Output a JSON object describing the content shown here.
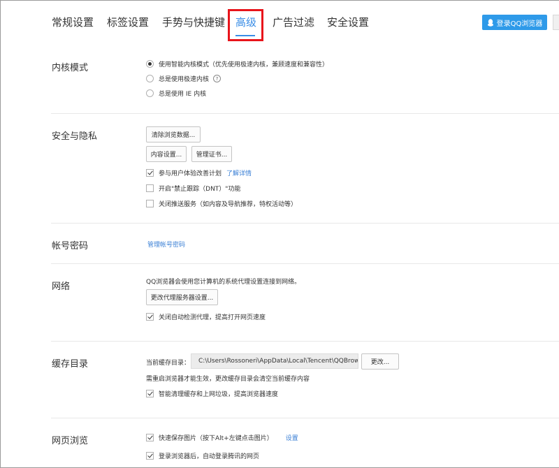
{
  "tabs": [
    {
      "label": "常规设置",
      "active": false
    },
    {
      "label": "标签设置",
      "active": false
    },
    {
      "label": "手势与快捷键",
      "active": false
    },
    {
      "label": "高级",
      "active": true
    },
    {
      "label": "广告过滤",
      "active": false
    },
    {
      "label": "安全设置",
      "active": false
    }
  ],
  "login_button": "登录QQ浏览器",
  "colors": {
    "accent": "#3a8de6",
    "highlight": "#e8141b",
    "login_bg": "#2e9ae9",
    "link": "#3a7fd5"
  },
  "kernel": {
    "title": "内核模式",
    "options": [
      {
        "label": "使用智能内核模式（优先使用极速内核，兼顾速度和兼容性）",
        "selected": true
      },
      {
        "label": "总是使用极速内核",
        "selected": false,
        "help": "?"
      },
      {
        "label": "总是使用 IE 内核",
        "selected": false
      }
    ]
  },
  "security": {
    "title": "安全与隐私",
    "clear_data_button": "清除浏览数据...",
    "content_settings_button": "内容设置...",
    "manage_certs_button": "管理证书...",
    "checks": [
      {
        "label": "参与用户体验改善计划",
        "checked": true,
        "link": "了解详情"
      },
      {
        "label": "开启\"禁止跟踪（DNT）\"功能",
        "checked": false
      },
      {
        "label": "关闭推送服务（如内容及导航推荐，特权活动等）",
        "checked": false
      }
    ]
  },
  "account": {
    "title": "帐号密码",
    "manage_link": "管理帐号密码"
  },
  "network": {
    "title": "网络",
    "desc": "QQ浏览器会使用您计算机的系统代理设置连接到网络。",
    "proxy_button": "更改代理服务器设置...",
    "check": {
      "label": "关闭自动检测代理，提高打开网页速度",
      "checked": true
    }
  },
  "cache": {
    "title": "缓存目录",
    "current_label": "当前缓存目录：",
    "path": "C:\\Users\\Rossoneri\\AppData\\Local\\Tencent\\QQBrow",
    "change_button": "更改...",
    "note": "需重启浏览器才能生效，更改缓存目录会清空当前缓存内容",
    "check": {
      "label": "智能清理缓存和上网垃圾，提高浏览器速度",
      "checked": true
    }
  },
  "browsing": {
    "title": "网页浏览",
    "checks": [
      {
        "label": "快速保存图片（按下Alt+左键点击图片）",
        "checked": true,
        "link": "设置"
      },
      {
        "label": "登录浏览器后，自动登录腾讯的网页",
        "checked": true
      }
    ]
  }
}
